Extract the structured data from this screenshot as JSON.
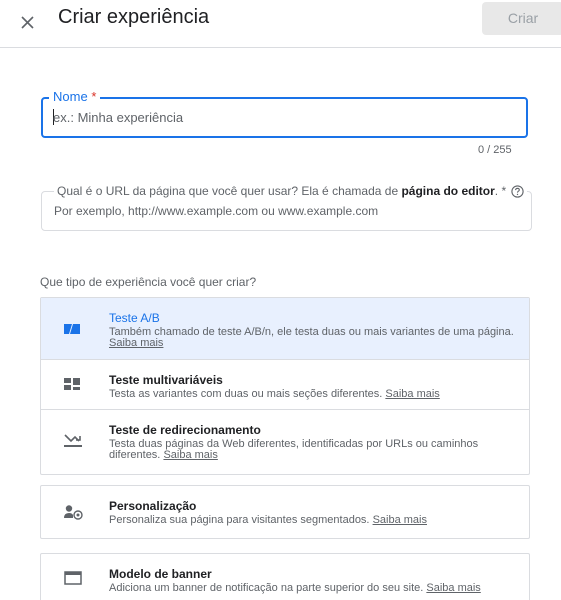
{
  "header": {
    "title": "Criar experiência",
    "create_label": "Criar"
  },
  "name_field": {
    "label": "Nome",
    "required_mark": "*",
    "placeholder": "ex.: Minha experiência",
    "counter": "0 / 255"
  },
  "url_field": {
    "label_prefix": "Qual é o URL da página que você quer usar? Ela é chamada de ",
    "label_bold": "página do editor",
    "label_suffix": ". *",
    "placeholder": "Por exemplo, http://www.example.com ou www.example.com"
  },
  "question": "Que tipo de experiência você quer criar?",
  "learn_more": "Saiba mais",
  "experience_types": [
    {
      "title": "Teste A/B",
      "description": "Também chamado de teste A/B/n, ele testa duas ou mais variantes de uma página.",
      "selected": true,
      "icon": "ab-test-icon"
    },
    {
      "title": "Teste multivariáveis",
      "description": "Testa as variantes com duas ou mais seções diferentes.",
      "selected": false,
      "icon": "multivariate-icon"
    },
    {
      "title": "Teste de redirecionamento",
      "description": "Testa duas páginas da Web diferentes, identificadas por URLs ou caminhos diferentes.",
      "selected": false,
      "icon": "redirect-icon"
    }
  ],
  "other_types": [
    {
      "title": "Personalização",
      "description": "Personaliza sua página para visitantes segmentados.",
      "icon": "personalization-icon"
    },
    {
      "title": "Modelo de banner",
      "description": "Adiciona um banner de notificação na parte superior do seu site.",
      "icon": "banner-icon"
    }
  ],
  "colors": {
    "accent": "#1a73e8",
    "selected_bg": "#e8f0fe",
    "required": "#d93025"
  }
}
